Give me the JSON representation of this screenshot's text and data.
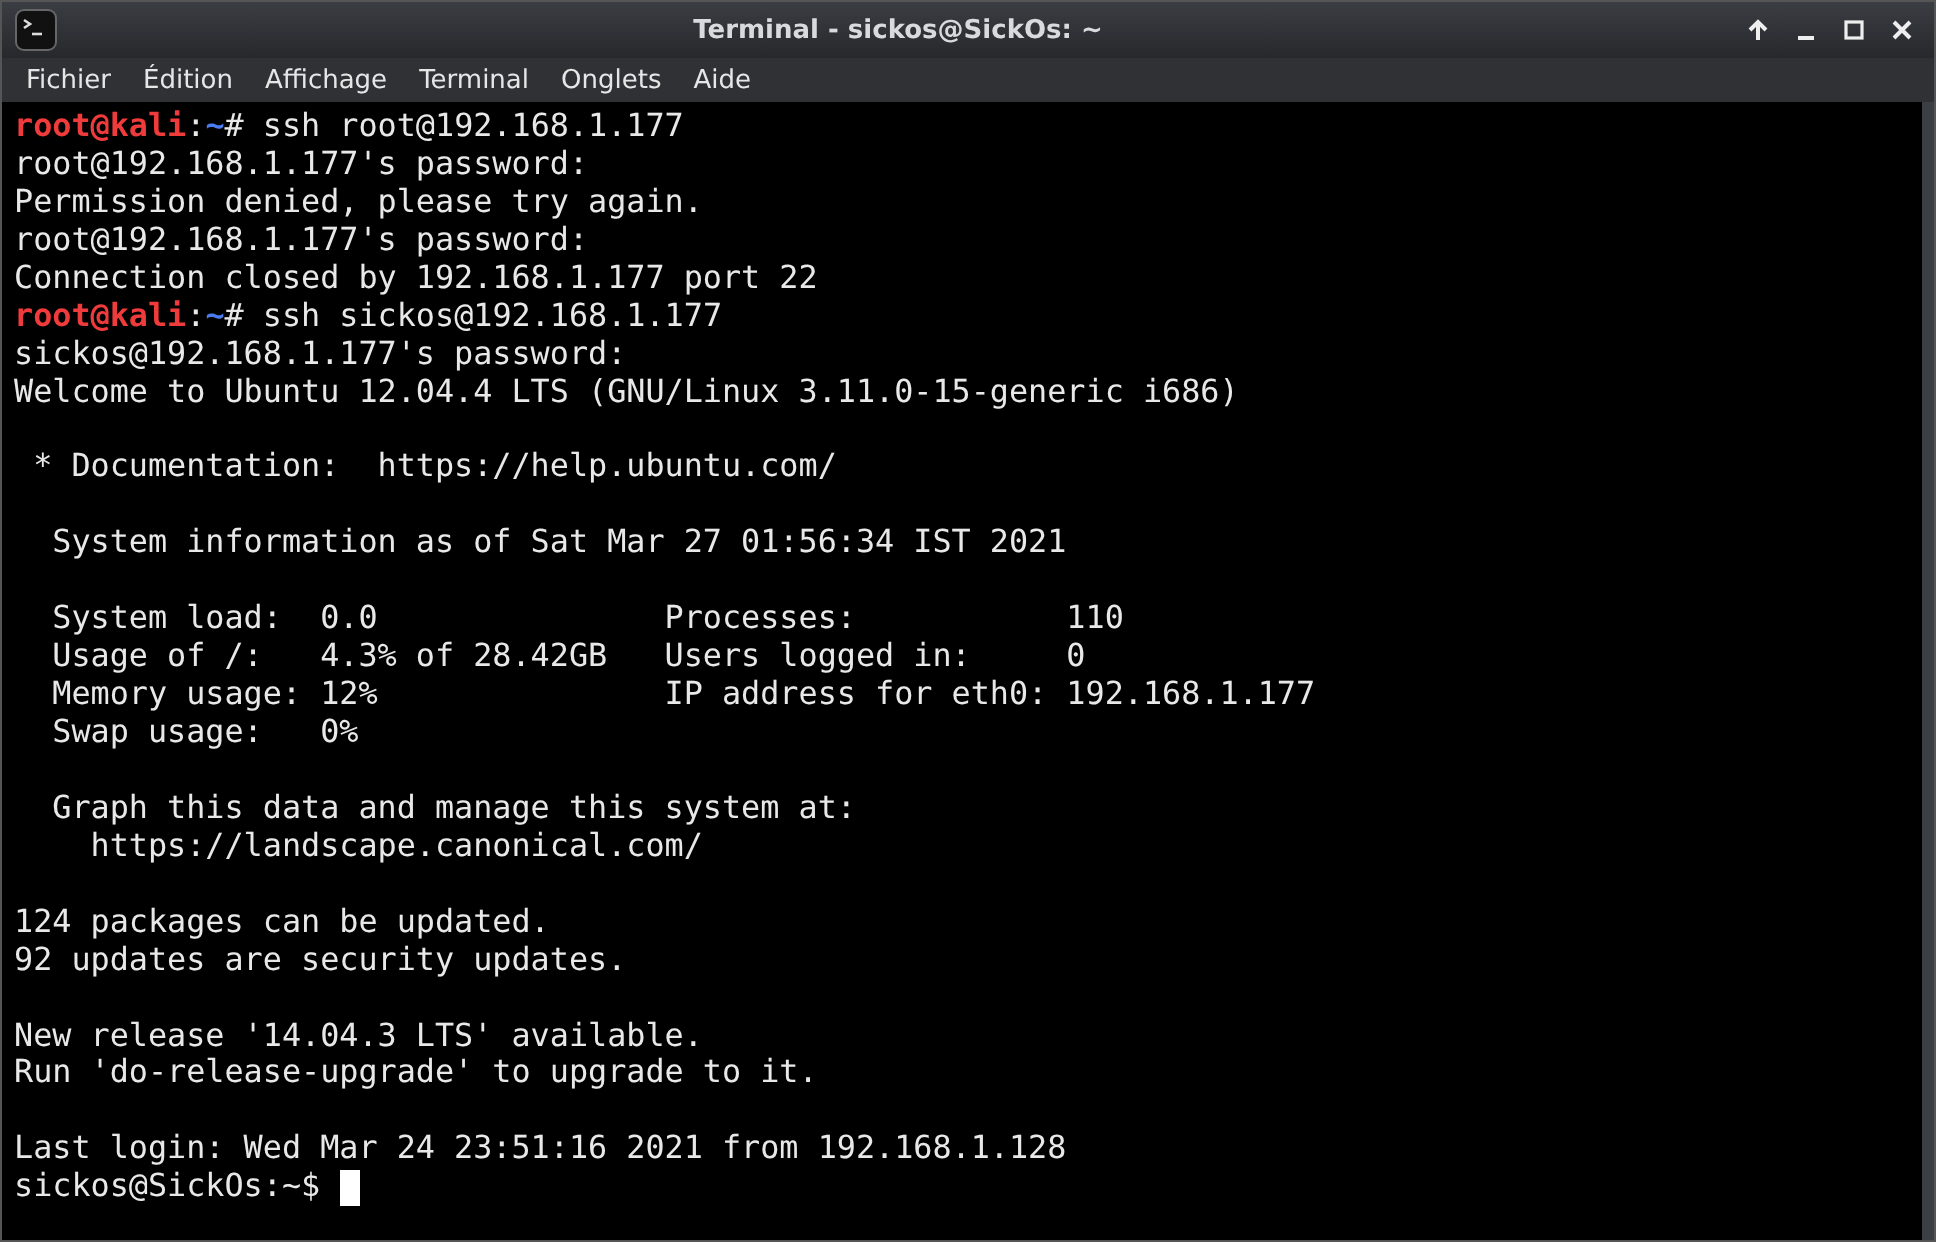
{
  "window": {
    "title": "Terminal - sickos@SickOs: ~"
  },
  "menu": [
    {
      "label": "Fichier"
    },
    {
      "label": "Édition"
    },
    {
      "label": "Affichage"
    },
    {
      "label": "Terminal"
    },
    {
      "label": "Onglets"
    },
    {
      "label": "Aide"
    }
  ],
  "lines": [
    {
      "kind": "root_prompt",
      "user": "root@kali",
      "sep": ":",
      "path": "~",
      "command": "# ssh root@192.168.1.177"
    },
    {
      "kind": "text",
      "text": "root@192.168.1.177's password:"
    },
    {
      "kind": "text",
      "text": "Permission denied, please try again."
    },
    {
      "kind": "text",
      "text": "root@192.168.1.177's password:"
    },
    {
      "kind": "text",
      "text": "Connection closed by 192.168.1.177 port 22"
    },
    {
      "kind": "root_prompt",
      "user": "root@kali",
      "sep": ":",
      "path": "~",
      "command": "# ssh sickos@192.168.1.177"
    },
    {
      "kind": "text",
      "text": "sickos@192.168.1.177's password:"
    },
    {
      "kind": "text",
      "text": "Welcome to Ubuntu 12.04.4 LTS (GNU/Linux 3.11.0-15-generic i686)"
    },
    {
      "kind": "blank"
    },
    {
      "kind": "text",
      "text": " * Documentation:  https://help.ubuntu.com/"
    },
    {
      "kind": "blank"
    },
    {
      "kind": "text",
      "text": "  System information as of Sat Mar 27 01:56:34 IST 2021"
    },
    {
      "kind": "blank"
    },
    {
      "kind": "text",
      "text": "  System load:  0.0               Processes:           110"
    },
    {
      "kind": "text",
      "text": "  Usage of /:   4.3% of 28.42GB   Users logged in:     0"
    },
    {
      "kind": "text",
      "text": "  Memory usage: 12%               IP address for eth0: 192.168.1.177"
    },
    {
      "kind": "text",
      "text": "  Swap usage:   0%"
    },
    {
      "kind": "blank"
    },
    {
      "kind": "text",
      "text": "  Graph this data and manage this system at:"
    },
    {
      "kind": "text",
      "text": "    https://landscape.canonical.com/"
    },
    {
      "kind": "blank"
    },
    {
      "kind": "text",
      "text": "124 packages can be updated."
    },
    {
      "kind": "text",
      "text": "92 updates are security updates."
    },
    {
      "kind": "blank"
    },
    {
      "kind": "text",
      "text": "New release '14.04.3 LTS' available."
    },
    {
      "kind": "text",
      "text": "Run 'do-release-upgrade' to upgrade to it."
    },
    {
      "kind": "blank"
    },
    {
      "kind": "text",
      "text": "Last login: Wed Mar 24 23:51:16 2021 from 192.168.1.128"
    },
    {
      "kind": "user_prompt",
      "text": "sickos@SickOs:~$ ",
      "cursor": true
    }
  ]
}
